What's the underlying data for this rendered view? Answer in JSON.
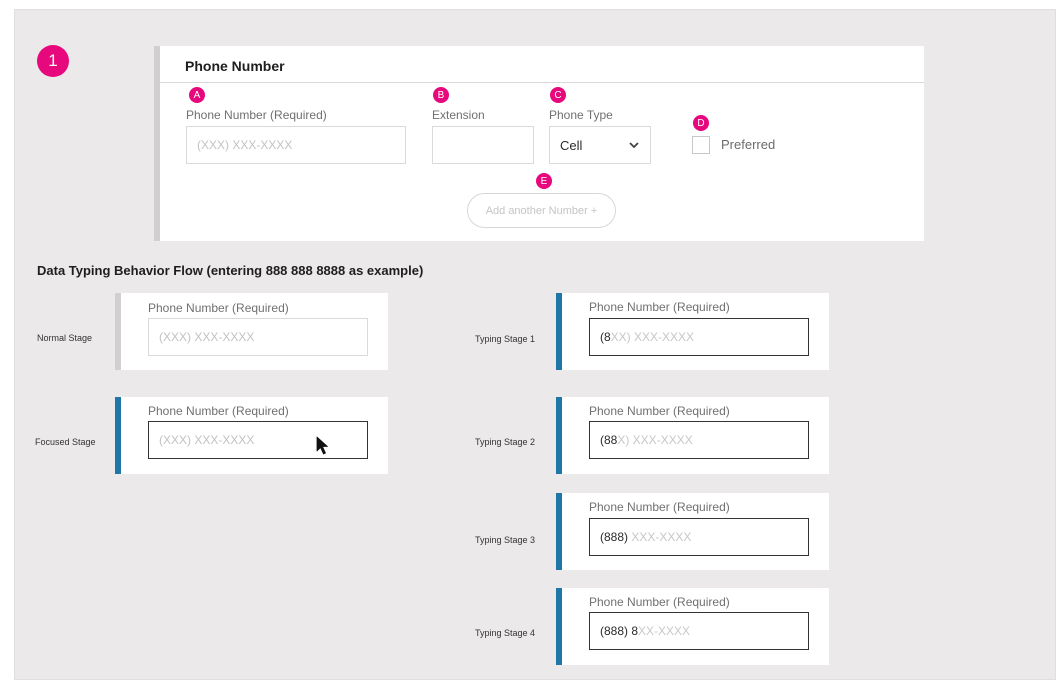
{
  "step": {
    "number": "1"
  },
  "panel": {
    "title": "Phone Number",
    "markers": {
      "a": "A",
      "b": "B",
      "c": "C",
      "d": "D",
      "e": "E"
    },
    "phone_label": "Phone Number (Required)",
    "phone_placeholder": "(XXX) XXX-XXXX",
    "extension_label": "Extension",
    "extension_value": "",
    "type_label": "Phone Type",
    "type_selected": "Cell",
    "preferred_label": "Preferred",
    "add_button": "Add another Number +"
  },
  "flow": {
    "title": "Data Typing Behavior Flow (entering 888 888 8888 as example)",
    "field_label": "Phone Number (Required)",
    "placeholder": "(XXX) XXX-XXXX",
    "normal_label": "Normal Stage",
    "focused_label": "Focused Stage",
    "typing": [
      {
        "label": "Typing Stage 1",
        "typed": "(8",
        "rest": "XX) XXX-XXXX"
      },
      {
        "label": "Typing Stage 2",
        "typed": "(88",
        "rest": "X) XXX-XXXX"
      },
      {
        "label": "Typing Stage 3",
        "typed": "(888)",
        "rest": " XXX-XXXX"
      },
      {
        "label": "Typing Stage 4",
        "typed": "(888) 8",
        "rest": "XX-XXXX"
      }
    ]
  },
  "colors": {
    "accent_pink": "#e6087c",
    "focus_blue": "#1f77a8",
    "card_border": "#d1cfcf"
  },
  "icons": {
    "select_chevron": "chevron-down-icon",
    "pointer": "mouse-pointer-icon"
  }
}
